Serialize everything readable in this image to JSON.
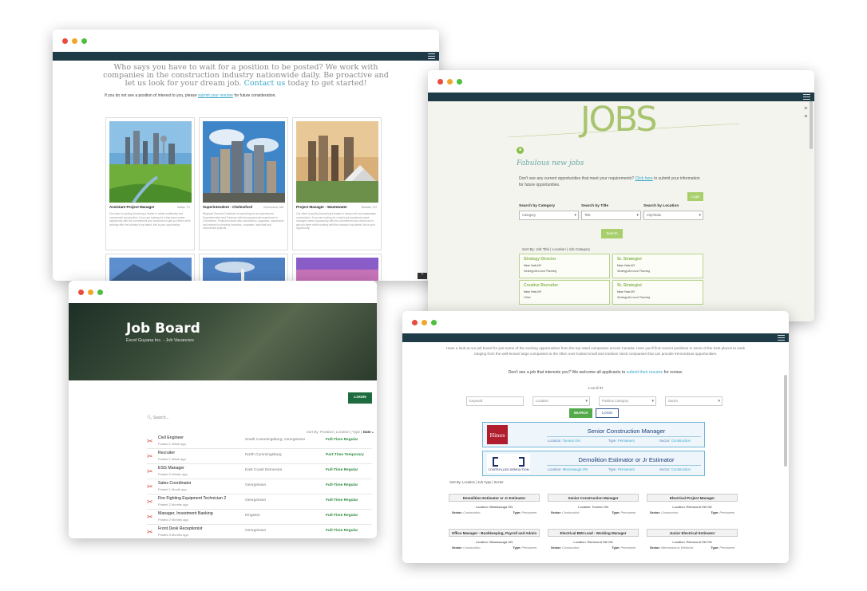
{
  "window1": {
    "tagline": "Who says you have to wait for a position to be posted? We work with companies in the construction industry nationwide daily. Be proactive and let us look for your dream job.",
    "contact_link": "Contact us",
    "tagline_end": "today to get started!",
    "note_prefix": "If you do not see a position of interest to you, please",
    "note_link": "submit your resume",
    "note_suffix": "for future consideration.",
    "cards": [
      {
        "title": "Assistant Project Manager",
        "location": "Dallas, TX",
        "text": "Our client is quickly becoming a leader in urban multifamily and commercial construction. If you are looking for a fast-track career opportunity with the commitment and resources to get you there while working with the industry's top talent, this is your opportunity!"
      },
      {
        "title": "Superintendent - Chelmsford",
        "location": "Chelmsford, MA",
        "text": "Regional General Contractor is searching for an experienced Superintendent and Foreman with strong personal experience in Chelmsford. Projects include new construction, upgrades, expansions and repairs for property investors, corporate, industrial and commercial projects."
      },
      {
        "title": "Project Manager - Wastewater",
        "location": "Boulder, CO",
        "text": "Our client is quickly becoming a leader in heavy civil and wastewater construction. If you are looking for a fast-track assistant project manager career opportunity with the commitment and resources to get you there while working with the industry's top talent, this is your opportunity!"
      }
    ]
  },
  "window2": {
    "hero_title": "JOBS",
    "subtitle": "Fabulous new jobs",
    "desc_prefix": "Don't see any current opportunities that meet your requirements?",
    "desc_link": "Click here",
    "desc_suffix": "to submit your information for future opportunities.",
    "login": "Login",
    "filters": [
      {
        "label": "Search by Category",
        "value": "Category"
      },
      {
        "label": "Search by Title",
        "value": "Title"
      },
      {
        "label": "Search by Location",
        "value": "City/State"
      }
    ],
    "search": "Search",
    "sort_prefix": "Sort By:",
    "sort_options": "Job Title | Location | Job Category",
    "jobs": [
      {
        "title": "Strategy Director",
        "location": "New York,NY",
        "category": "Strategy/Account Planning"
      },
      {
        "title": "Sr. Strategist",
        "location": "New York,NY",
        "category": "Strategy/Account Planning"
      },
      {
        "title": "Creative Recruiter",
        "location": "New York,NY",
        "category": "Other"
      },
      {
        "title": "Sr. Strategist",
        "location": "New York,NY",
        "category": "Strategy/Account Planning"
      }
    ]
  },
  "window3": {
    "title": "Job Board",
    "subtitle": "Excel Guyana Inc. - Job Vacancies",
    "login": "LOGIN",
    "search_placeholder": "Search...",
    "sort_prefix": "Sort By: Position | Location | Type |",
    "sort_active": "Date",
    "jobs": [
      {
        "title": "Civil Engineer",
        "posted": "Posted 1 Week ago",
        "location": "South Cummingsburg, Georgetown",
        "type": "Full-Time Regular"
      },
      {
        "title": "Recruiter",
        "posted": "Posted 1 Week ago",
        "location": "North Cummingsburg",
        "type": "Part-Time Temporary"
      },
      {
        "title": "ESG Manager",
        "posted": "Posted 2 Weeks ago",
        "location": "East Coast Demerara",
        "type": "Full-Time Regular"
      },
      {
        "title": "Sales Coordinator",
        "posted": "Posted 1 Month ago",
        "location": "Georgetown",
        "type": "Full-Time Regular"
      },
      {
        "title": "Fire Fighting Equipment Technician 2",
        "posted": "Posted 2 Months ago",
        "location": "Georgetown",
        "type": "Full-Time Regular"
      },
      {
        "title": "Manager, Investment Banking",
        "posted": "Posted 2 Months ago",
        "location": "Kingston",
        "type": "Full-Time Regular"
      },
      {
        "title": "Front Desk Receptionist",
        "posted": "Posted 3 Months ago",
        "location": "Georgetown",
        "type": "Full-Time Regular"
      }
    ]
  },
  "window4": {
    "intro": "Have a look at our job board for just some of the exciting opportunities from the top rated companies across Canada. Here you'll find current positions in some of the best places to work ranging from the well-known large companies to the often over-looked small and medium sized companies that can provide tremendous opportunities.",
    "dont_prefix": "Don't see a job that interests you? We welcome all applicants to",
    "dont_link": "submit their resume",
    "dont_suffix": "for review.",
    "count": "1-12 of 37",
    "filters": [
      "Keyword",
      "Location",
      "Position Category",
      "Sector"
    ],
    "search": "SEARCH",
    "login": "LOGIN",
    "featured": [
      {
        "logo_text": "Hines",
        "title": "Senior Construction Manager",
        "location": "Toronto ON",
        "type": "Permanent",
        "sector": "Construction"
      },
      {
        "logo_text": "CONTROLLED DEMOLITION",
        "title": "Demolition Estimator or Jr Estimator",
        "location": "Mississauga ON",
        "type": "Permanent",
        "sector": "Construction"
      }
    ],
    "loc_label": "Location:",
    "type_label": "Type:",
    "sector_label": "Sector:",
    "sort": "Sort By: Location | Job Type | Sector",
    "jobs": [
      {
        "title": "Demolition Estimator or Jr Estimator",
        "location": "Mississauga ON",
        "sector": "Construction",
        "type": "Permanent"
      },
      {
        "title": "Senior Construction Manager",
        "location": "Toronto ON",
        "sector": "Construction",
        "type": "Permanent"
      },
      {
        "title": "Electrical Project Manager",
        "location": "Richmond Hill ON",
        "sector": "Construction",
        "type": "Permanent"
      },
      {
        "title": "Office Manager - Bookkeeping, Payroll and Admin",
        "location": "Mississauga ON",
        "sector": "Construction",
        "type": "Permanent"
      },
      {
        "title": "Electrical BIM Lead - Working Manager",
        "location": "Richmond Hill ON",
        "sector": "Construction",
        "type": "Permanent"
      },
      {
        "title": "Junior Electrical Estimator",
        "location": "Richmond Hill ON",
        "sector": "Mechanical or Electrical",
        "type": "Permanent"
      }
    ]
  }
}
